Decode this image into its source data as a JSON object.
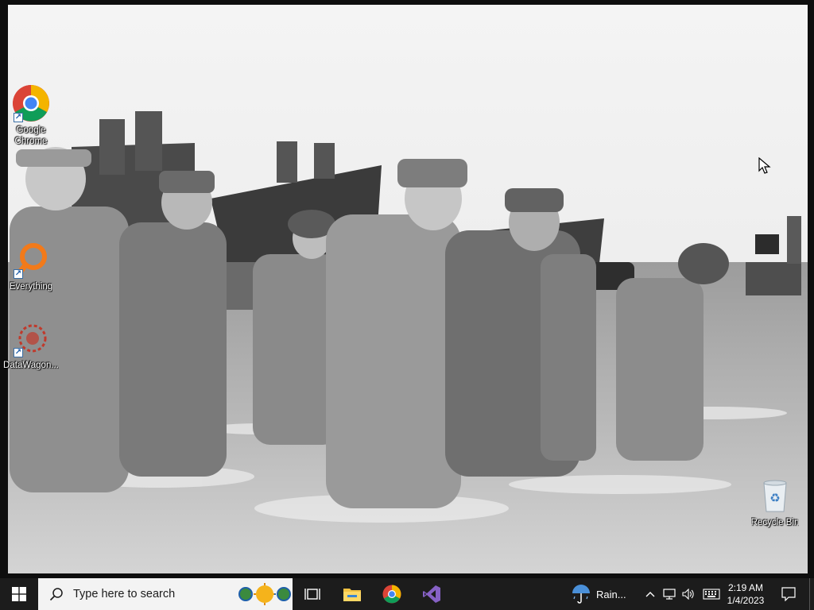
{
  "desktop": {
    "icons": [
      {
        "name": "Google Chrome",
        "label": "Google Chrome",
        "icon": "chrome-icon"
      },
      {
        "name": "Everything",
        "label": "Everything",
        "icon": "everything-search-icon"
      },
      {
        "name": "DataWagon",
        "label": "DataWagon...",
        "icon": "datawagon-icon"
      },
      {
        "name": "Recycle Bin",
        "label": "Recycle Bin",
        "icon": "recycle-bin-icon"
      }
    ],
    "wallpaper": "grayscale-historical-photo"
  },
  "taskbar": {
    "start_icon": "windows-logo-icon",
    "search_placeholder": "Type here to search",
    "pinned": [
      {
        "name": "task-view",
        "icon": "task-view-icon"
      },
      {
        "name": "file-explorer",
        "icon": "folder-icon"
      },
      {
        "name": "google-chrome",
        "icon": "chrome-icon"
      },
      {
        "name": "visual-studio",
        "icon": "visual-studio-icon"
      }
    ],
    "weather_text": "Rain...",
    "clock": {
      "time": "2:19 AM",
      "date": "1/4/2023"
    },
    "colors": {
      "bar": "#1c1c1c",
      "search_bg": "#f3f3f3",
      "vs_purple": "#8661c5"
    }
  }
}
